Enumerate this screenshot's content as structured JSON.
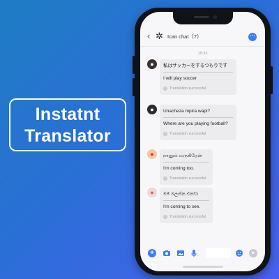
{
  "headline": {
    "line1": "Instatnt",
    "line2": "Translator"
  },
  "chat": {
    "title": "Ican chat（7）",
    "time": "15:33",
    "messages": [
      {
        "original": "私はサッカーをするつもりです",
        "translation": "I will play soccer",
        "status": "Translation successful"
      },
      {
        "original": "Unacheza mpira wapi?",
        "translation": "Where are you playing football?",
        "status": "Translation successful"
      },
      {
        "original": "நானும் வருகிறேன்",
        "translation": "I'm coming too.",
        "status": "Translation successful"
      },
      {
        "original": "මම බලන්න එනවා",
        "translation": "I'm coming to see.",
        "status": "Translation successful"
      }
    ]
  },
  "icons": {
    "back": "back-arrow-icon",
    "group": "gear-icon",
    "more": "more-icon",
    "add": "plus-icon",
    "camera": "camera-icon",
    "image": "image-icon",
    "mic": "microphone-icon",
    "emoji": "emoji-icon",
    "send": "send-icon"
  },
  "colors": {
    "accent": "#3d7ef5",
    "background_start": "#1f7cc4",
    "background_end": "#4a5ff0"
  }
}
